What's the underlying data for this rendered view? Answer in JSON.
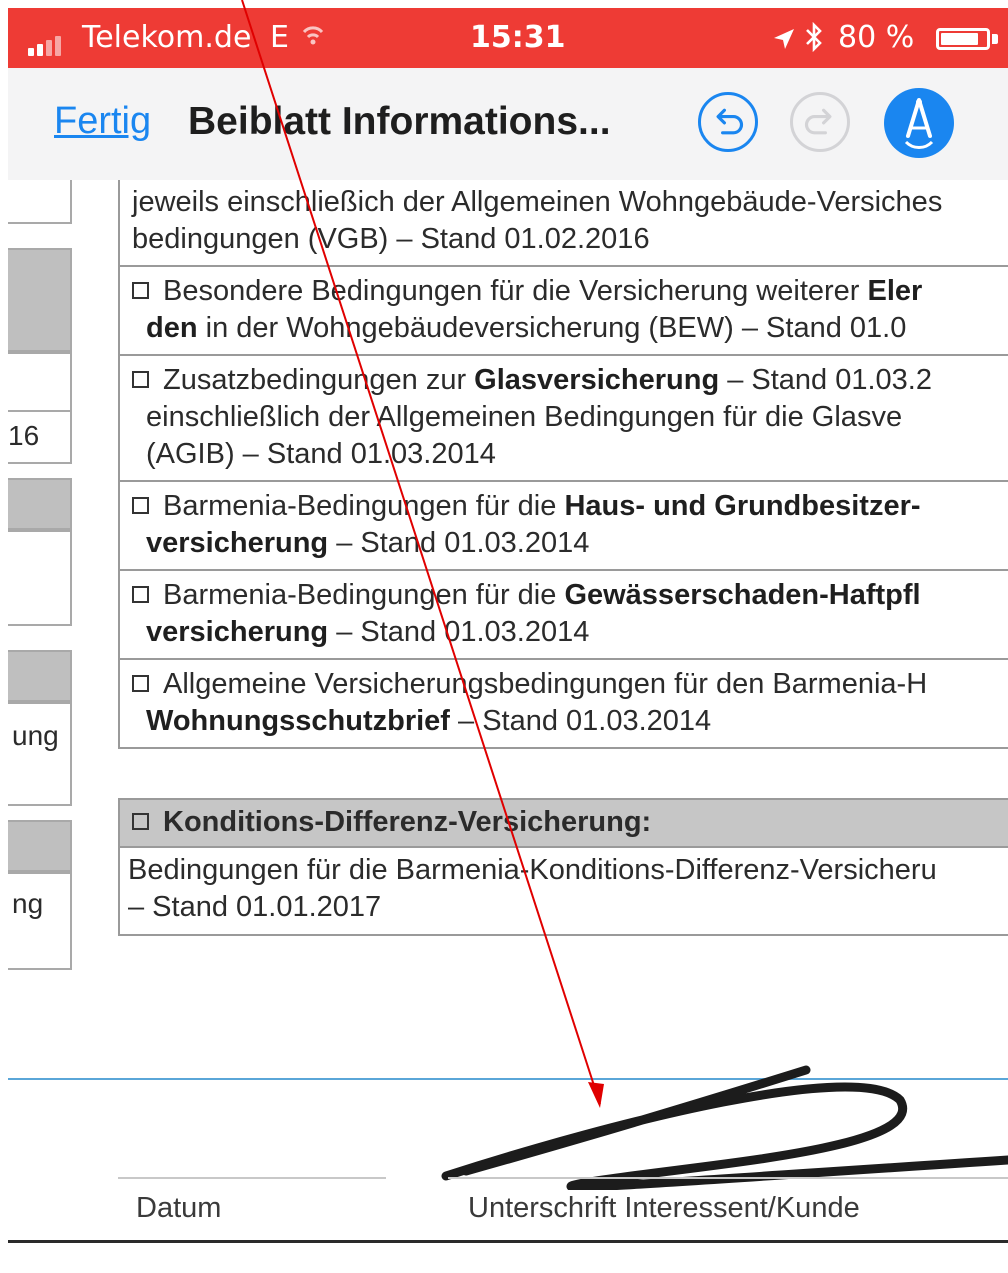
{
  "status_bar": {
    "carrier": "Telekom.de",
    "network": "E",
    "time": "15:31",
    "battery": "80 %",
    "battery_level": 0.8,
    "background_color": "#ee3b35",
    "icons": [
      "signal-icon",
      "wifi-icon",
      "location-arrow-icon",
      "bluetooth-icon",
      "battery-icon"
    ]
  },
  "nav": {
    "done_label": "Fertig",
    "title": "Beiblatt Informations...",
    "accent_color": "#1a86f0",
    "icons": [
      "undo-icon",
      "redo-icon",
      "markup-pen-icon"
    ]
  },
  "left_column": {
    "fragments": [
      "16",
      "ung",
      "ng"
    ]
  },
  "conditions": [
    {
      "checkbox": false,
      "parts": [
        {
          "text": "jeweils einschließich der Allgemeinen Wohngebäude-Versiches",
          "bold": false
        },
        {
          "text": "bedingungen (VGB) – Stand 01.02.2016",
          "bold": false
        }
      ]
    },
    {
      "checkbox": true,
      "line1": [
        {
          "text": "Besondere Bedingungen für die Versicherung weiterer ",
          "bold": false
        },
        {
          "text": "Eler",
          "bold": true
        }
      ],
      "line2": [
        {
          "text": "den",
          "bold": true
        },
        {
          "text": " in der Wohngebäudeversicherung (BEW) – Stand 01.0",
          "bold": false
        }
      ]
    },
    {
      "checkbox": true,
      "line1": [
        {
          "text": "Zusatzbedingungen zur ",
          "bold": false
        },
        {
          "text": "Glasversicherung",
          "bold": true
        },
        {
          "text": " – Stand 01.03.2",
          "bold": false
        }
      ],
      "line2": [
        {
          "text": "einschließlich der Allgemeinen Bedingungen für die Glasve",
          "bold": false
        }
      ],
      "line3": [
        {
          "text": "(AGIB) – Stand 01.03.2014",
          "bold": false
        }
      ]
    },
    {
      "checkbox": true,
      "line1": [
        {
          "text": "Barmenia-Bedingungen für die ",
          "bold": false
        },
        {
          "text": "Haus- und Grundbesitzer-",
          "bold": true
        }
      ],
      "line2": [
        {
          "text": "versicherung",
          "bold": true
        },
        {
          "text": " – Stand 01.03.2014",
          "bold": false
        }
      ]
    },
    {
      "checkbox": true,
      "line1": [
        {
          "text": "Barmenia-Bedingungen für die ",
          "bold": false
        },
        {
          "text": "Gewässerschaden-Haftpfl",
          "bold": true
        }
      ],
      "line2": [
        {
          "text": "versicherung",
          "bold": true
        },
        {
          "text": " – Stand 01.03.2014",
          "bold": false
        }
      ]
    },
    {
      "checkbox": true,
      "line1": [
        {
          "text": "Allgemeine Versicherungsbedingungen für den Barmenia-H",
          "bold": false
        }
      ],
      "line2": [
        {
          "text": "Wohnungsschutzbrief",
          "bold": true
        },
        {
          "text": " – Stand 01.03.2014",
          "bold": false
        }
      ]
    }
  ],
  "kd": {
    "heading": "Konditions-Differenz-Versicherung:",
    "body_line1": "Bedingungen für die Barmenia-Konditions-Differenz-Versicheru",
    "body_line2": "– Stand 01.01.2017"
  },
  "signature": {
    "date_label": "Datum",
    "signer_label": "Unterschrift Interessent/Kunde",
    "ink_color": "#1c1c1c"
  },
  "annotation": {
    "arrow_color": "#e00000"
  }
}
